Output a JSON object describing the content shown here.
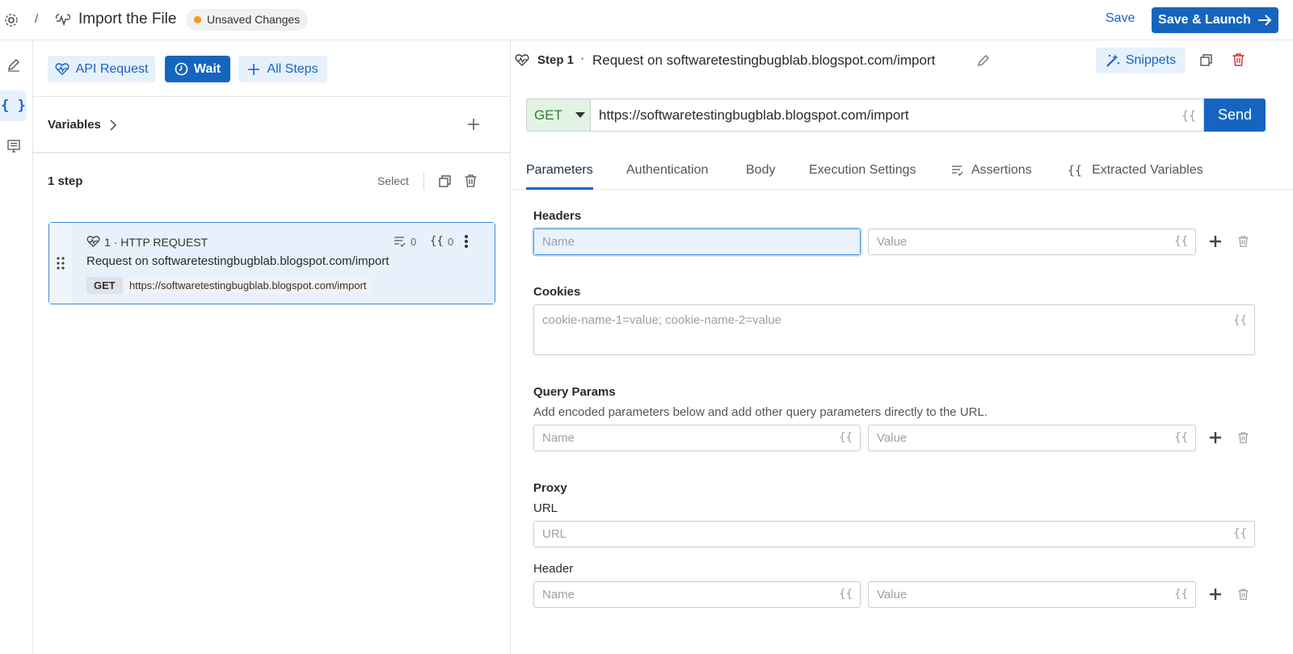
{
  "header": {
    "breadcrumb_sep": "/",
    "title": "Import the File",
    "status_badge": "Unsaved Changes",
    "save_label": "Save",
    "save_launch_label": "Save & Launch"
  },
  "sidebar": {
    "items": [
      {
        "icon": "pencil-icon"
      },
      {
        "icon": "curly-braces-icon",
        "active": true
      },
      {
        "icon": "list-icon"
      }
    ]
  },
  "left": {
    "chips": [
      {
        "label": "API Request",
        "icon": "heartbeat-icon"
      },
      {
        "label": "Wait",
        "icon": "clock-icon"
      },
      {
        "label": "All Steps",
        "icon": "plus-icon"
      }
    ],
    "variables_label": "Variables",
    "steps_count": "1 step",
    "select_label": "Select",
    "step": {
      "header": "1 · HTTP REQUEST",
      "assertions_count": "0",
      "variables_count": "0",
      "name": "Request on softwaretestingbugblab.blogspot.com/import",
      "method": "GET",
      "url": "https://softwaretestingbugblab.blogspot.com/import"
    }
  },
  "right": {
    "step_label": "Step 1",
    "step_dot": "·",
    "step_title": "Request on softwaretestingbugblab.blogspot.com/import",
    "snippets_label": "Snippets",
    "method": "GET",
    "url": "https://softwaretestingbugblab.blogspot.com/import",
    "send_label": "Send",
    "curly": "{{",
    "tabs": [
      {
        "label": "Parameters",
        "active": true
      },
      {
        "label": "Authentication"
      },
      {
        "label": "Body"
      },
      {
        "label": "Execution Settings"
      },
      {
        "label": "Assertions",
        "icon": "assertions-icon"
      },
      {
        "label": "Extracted Variables",
        "icon": "curly-braces-icon"
      }
    ],
    "headers": {
      "label": "Headers",
      "name_placeholder": "Name",
      "value_placeholder": "Value"
    },
    "cookies": {
      "label": "Cookies",
      "placeholder": "cookie-name-1=value; cookie-name-2=value"
    },
    "query": {
      "label": "Query Params",
      "hint": "Add encoded parameters below and add other query parameters directly to the URL.",
      "name_placeholder": "Name",
      "value_placeholder": "Value"
    },
    "proxy": {
      "label": "Proxy",
      "url_label": "URL",
      "url_placeholder": "URL",
      "header_label": "Header",
      "name_placeholder": "Name",
      "value_placeholder": "Value"
    }
  },
  "colors": {
    "accent": "#1565c0",
    "status_dot": "#f29b16",
    "method_bg": "#e3f3e3",
    "method_text": "#2e7d32"
  }
}
